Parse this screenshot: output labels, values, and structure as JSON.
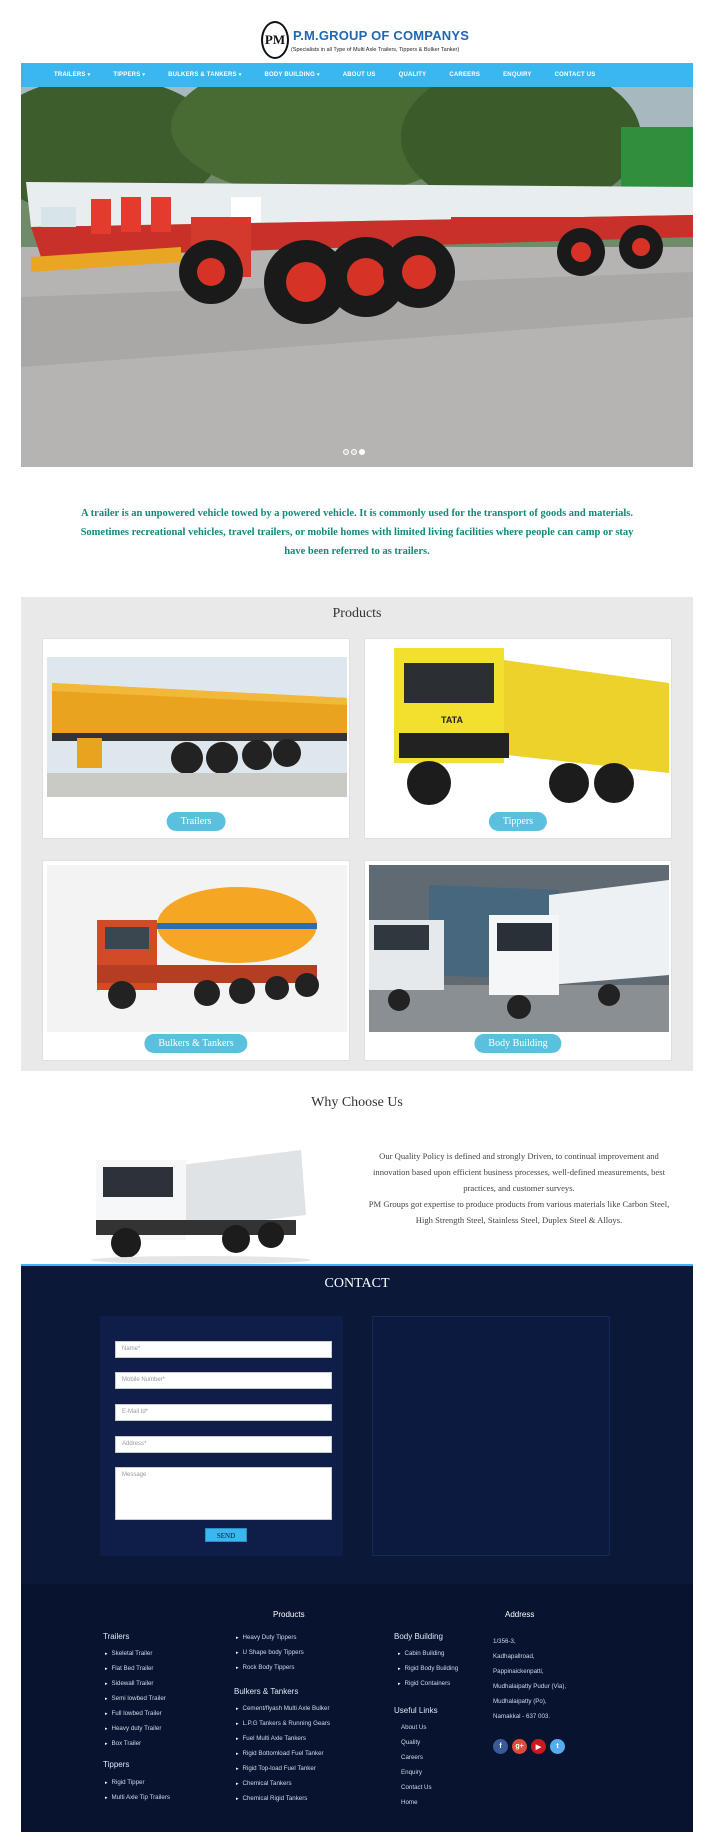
{
  "header": {
    "logo_mark": "PM",
    "title": "P.M.GROUP OF COMPANYS",
    "tagline": "(Specialists in all Type of Multi Axle Trailers, Tippers & Bulker Tanker)"
  },
  "nav": {
    "items": [
      {
        "label": "TRAILERS",
        "dropdown": true
      },
      {
        "label": "TIPPERS",
        "dropdown": true
      },
      {
        "label": "BULKERS & TANKERS",
        "dropdown": true
      },
      {
        "label": "BODY BUILDING",
        "dropdown": true
      },
      {
        "label": "ABOUT US",
        "dropdown": false
      },
      {
        "label": "QUALITY",
        "dropdown": false
      },
      {
        "label": "CAREERS",
        "dropdown": false
      },
      {
        "label": "ENQUIRY",
        "dropdown": false
      },
      {
        "label": "CONTACT US",
        "dropdown": false
      }
    ],
    "caret": "▾"
  },
  "hero": {
    "image": "red-flatbed-trailer-photo",
    "slides": 3,
    "active_slide": 3
  },
  "intro": {
    "text": "A trailer is an unpowered vehicle towed by a powered vehicle. It is commonly used for the transport of goods and materials. Sometimes recreational vehicles, travel trailers, or mobile homes with limited living facilities where people can camp or stay have been referred to as trailers."
  },
  "products": {
    "title": "Products",
    "items": [
      {
        "label": "Trailers",
        "image": "orange-side-wall-trailer"
      },
      {
        "label": "Tippers",
        "image": "yellow-tata-tipper-truck"
      },
      {
        "label": "Bulkers & Tankers",
        "image": "orange-bulker-tanker-truck"
      },
      {
        "label": "Body Building",
        "image": "white-container-trucks"
      }
    ]
  },
  "why": {
    "title": "Why Choose Us",
    "image": "white-isuzu-tipper-truck",
    "p1": "Our Quality Policy is defined and strongly Driven, to continual improvement and innovation based upon efficient business processes, well-defined measurements, best practices, and customer surveys.",
    "p2": "PM Groups got expertise to produce products from various materials like Carbon Steel, High Strength Steel, Stainless Steel, Duplex Steel & Alloys."
  },
  "contact": {
    "title": "CONTACT",
    "placeholders": {
      "name": "Name*",
      "mobile": "Mobile Number*",
      "email": "E-Mail Id*",
      "address": "Address*",
      "message": "Message"
    },
    "send_label": "SEND"
  },
  "footer": {
    "products_heading": "Products",
    "address_heading": "Address",
    "trailers": {
      "heading": "Trailers",
      "items": [
        "Skeletal Trailer",
        "Flat Bed Trailer",
        "Sidewall Trailer",
        "Semi lowbed Trailer",
        "Full lowbed Trailer",
        "Heavy duty Trailer",
        "Box Trailer"
      ]
    },
    "tippers": {
      "heading": "Tippers",
      "items": [
        "Rigid Tipper",
        "Multi Axle Tip Trailers"
      ]
    },
    "tipper_types": {
      "items": [
        "Heavy Duty Tippers",
        "U Shape body Tippers",
        "Rock Body Tippers"
      ]
    },
    "bulkers": {
      "heading": "Bulkers & Tankers",
      "items": [
        "Cement/flyash Multi Axle Bulker",
        "L.P.G Tankers & Running Gears",
        "Fuel Multi Axle Tankers",
        "Rigid Bottomload Fuel Tanker",
        "Rigid Top-load Fuel Tanker",
        "Chemical Tankers",
        "Chemical Rigid Tankers"
      ]
    },
    "body_building": {
      "heading": "Body Building",
      "items": [
        "Cabin Building",
        "Rigid Body Building",
        "Rigid Containers"
      ]
    },
    "useful_links": {
      "heading": "Useful Links",
      "items": [
        "About Us",
        "Quality",
        "Careers",
        "Enquiry",
        "Contact Us",
        "Home"
      ]
    },
    "address_lines": [
      "1/356-3,",
      "Kadhapallroad,",
      "Pappinaickenpatti,",
      "Mudhalaipatty Pudur (Via),",
      "Mudhalaipatty (Po),",
      "Namakkal - 637 003."
    ],
    "social": [
      {
        "icon": "facebook-icon",
        "glyph": "f",
        "color": "#3b5998"
      },
      {
        "icon": "google-plus-icon",
        "glyph": "g+",
        "color": "#dd4b39"
      },
      {
        "icon": "youtube-icon",
        "glyph": "▶",
        "color": "#cc181e"
      },
      {
        "icon": "twitter-icon",
        "glyph": "t",
        "color": "#55acee"
      }
    ]
  }
}
